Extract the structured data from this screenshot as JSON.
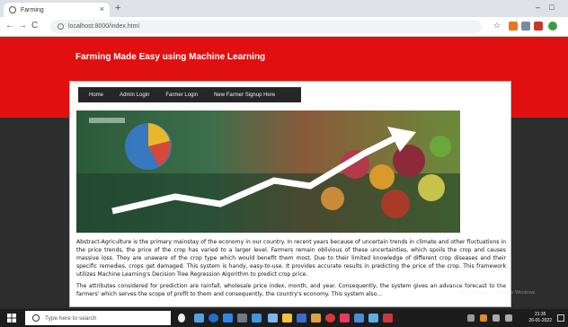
{
  "browser": {
    "tab_title": "Farming",
    "tab_close": "×",
    "new_tab": "+",
    "url": "localhost:8000/index.html",
    "window_controls": {
      "minimize": "–",
      "maximize": "□"
    },
    "nav": {
      "back": "←",
      "forward": "→",
      "reload": "C"
    }
  },
  "site": {
    "title": "Farming Made Easy using Machine Learning",
    "menu": [
      "Home",
      "Admin Login",
      "Farmer Login",
      "New Farmer Signup Here"
    ],
    "abstract": "Abstract-Agriculture is the primary mainstay of the economy in our country. In recent years because of uncertain trends in climate and other fluctuations in the price trends, the price of the crop has varied to a larger level. Farmers remain oblivious of these uncertainties, which spoils the crop and causes massive loss. They are unaware of the crop type which would benefit them most. Due to their limited knowledge of different crop diseases and their specific remedies, crops get damaged. This system is handy, easy-to-use. It provides accurate results in predicting the price of the crop. This framework utilizes Machine Learning's Decision Tree Regression Algorithm to predict crop price.",
    "attributes": "The attributes considered for prediction are rainfall, wholesale price index, month, and year. Consequently, the system gives an advance forecast to the farmers' which serves the scope of profit to them and consequently, the country's economy. This system also..."
  },
  "os": {
    "watermark": "Activate Windows",
    "watermark_sub": "Go to Settings to activate Windows.",
    "search_placeholder": "Type here to search",
    "time": "21:35",
    "date": "26-01-2022"
  },
  "colors": {
    "header_red": "#e01010",
    "menu_dark": "#262626",
    "page_dark": "#2d2d2d"
  }
}
